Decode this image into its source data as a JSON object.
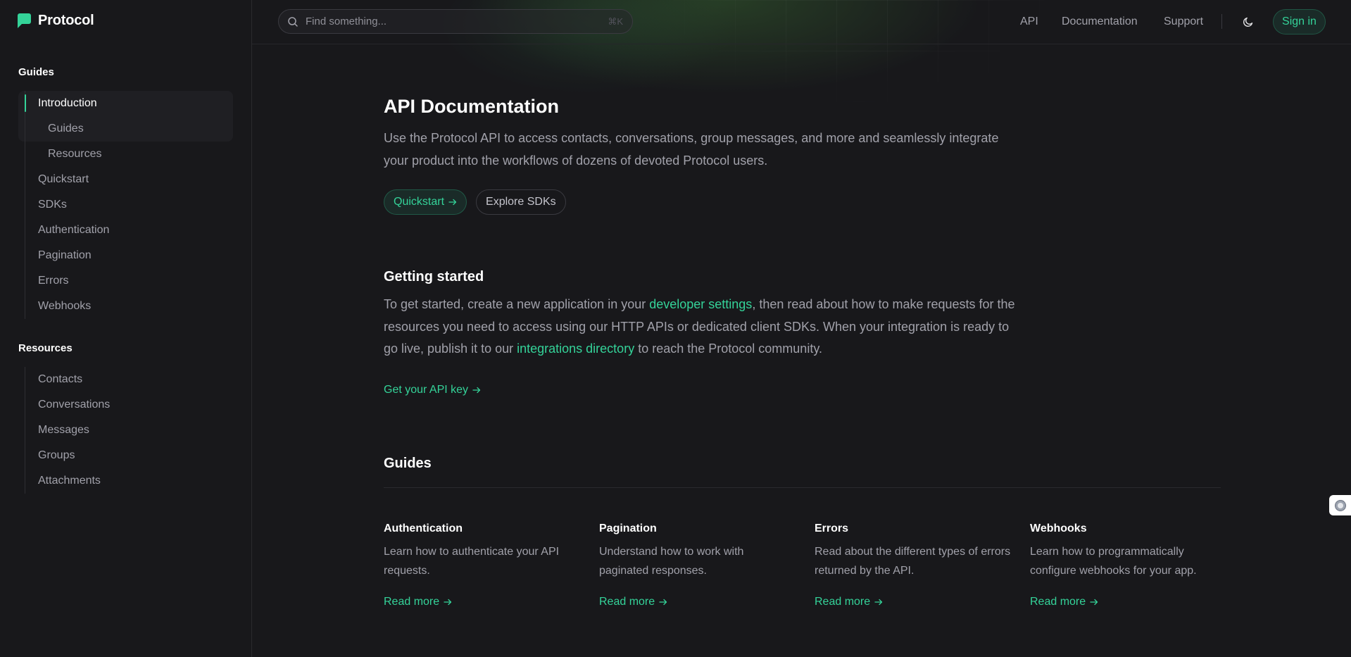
{
  "app": {
    "brand": "Protocol",
    "brand_color": "#34d399"
  },
  "search": {
    "placeholder": "Find something...",
    "shortcut": "⌘K"
  },
  "header": {
    "links": [
      "API",
      "Documentation",
      "Support"
    ],
    "theme_toggle_icon": "moon-icon",
    "signin_label": "Sign in"
  },
  "sidebar": {
    "sections": [
      {
        "title": "Guides",
        "items": [
          {
            "label": "Introduction",
            "active": true
          },
          {
            "label": "Guides",
            "sub": true
          },
          {
            "label": "Resources",
            "sub": true
          },
          {
            "label": "Quickstart"
          },
          {
            "label": "SDKs"
          },
          {
            "label": "Authentication"
          },
          {
            "label": "Pagination"
          },
          {
            "label": "Errors"
          },
          {
            "label": "Webhooks"
          }
        ]
      },
      {
        "title": "Resources",
        "items": [
          {
            "label": "Contacts"
          },
          {
            "label": "Conversations"
          },
          {
            "label": "Messages"
          },
          {
            "label": "Groups"
          },
          {
            "label": "Attachments"
          }
        ]
      }
    ]
  },
  "main": {
    "title": "API Documentation",
    "lead": "Use the Protocol API to access contacts, conversations, group messages, and more and seamlessly integrate your product into the workflows of dozens of devoted Protocol users.",
    "buttons": {
      "primary": "Quickstart",
      "secondary": "Explore SDKs"
    },
    "getting_started": {
      "title": "Getting started",
      "text_1": "To get started, create a new application in your ",
      "link_1": "developer settings",
      "text_2": ", then read about how to make requests for the resources you need to access using our HTTP APIs or dedicated client SDKs. When your integration is ready to go live, publish it to our ",
      "link_2": "integrations directory",
      "text_3": " to reach the Protocol community.",
      "api_key_link": "Get your API key"
    },
    "guides": {
      "title": "Guides",
      "cards": [
        {
          "title": "Authentication",
          "desc": "Learn how to authenticate your API requests.",
          "link": "Read more"
        },
        {
          "title": "Pagination",
          "desc": "Understand how to work with paginated responses.",
          "link": "Read more"
        },
        {
          "title": "Errors",
          "desc": "Read about the different types of errors returned by the API.",
          "link": "Read more"
        },
        {
          "title": "Webhooks",
          "desc": "Learn how to programmatically configure webhooks for your app.",
          "link": "Read more"
        }
      ]
    }
  }
}
